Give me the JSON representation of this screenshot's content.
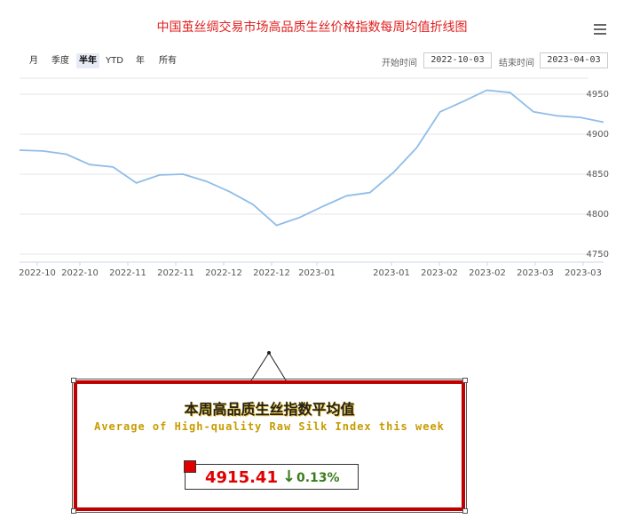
{
  "title": "中国茧丝绸交易市场高品质生丝价格指数每周均值折线图",
  "range_buttons": [
    "月",
    "季度",
    "半年",
    "YTD",
    "年",
    "所有"
  ],
  "active_range": "半年",
  "date_range": {
    "start_label": "开始时间",
    "start_value": "2022-10-03",
    "end_label": "结束时间",
    "end_value": "2023-04-03"
  },
  "chart_data": {
    "type": "line",
    "title": "中国茧丝绸交易市场高品质生丝价格指数每周均值折线图",
    "xlabel": "",
    "ylabel": "",
    "ylim": [
      4740,
      4970
    ],
    "yticks": [
      4750,
      4800,
      4850,
      4900,
      4950
    ],
    "xtick_labels": [
      "2022-10",
      "2022-10",
      "2022-11",
      "2022-11",
      "2022-12",
      "2022-12",
      "2023-01",
      "2023-01",
      "2023-02",
      "2023-02",
      "2023-03",
      "2023-03"
    ],
    "grid": true,
    "line_color": "#90bde8",
    "values": [
      4880,
      4879,
      4875,
      4862,
      4859,
      4839,
      4849,
      4850,
      4841,
      4828,
      4812,
      4786,
      4796,
      4810,
      4823,
      4827,
      4852,
      4883,
      4928,
      4941,
      4955,
      4952,
      4928,
      4923,
      4921,
      4915
    ]
  },
  "callout": {
    "title_cn": "本周高品质生丝指数平均值",
    "title_en": "Average of High-quality Raw Silk Index this week",
    "value": "4915.41",
    "arrow": "↓",
    "change": "0.13%",
    "value_color": "#e00000",
    "change_color": "#3a7d1c"
  }
}
